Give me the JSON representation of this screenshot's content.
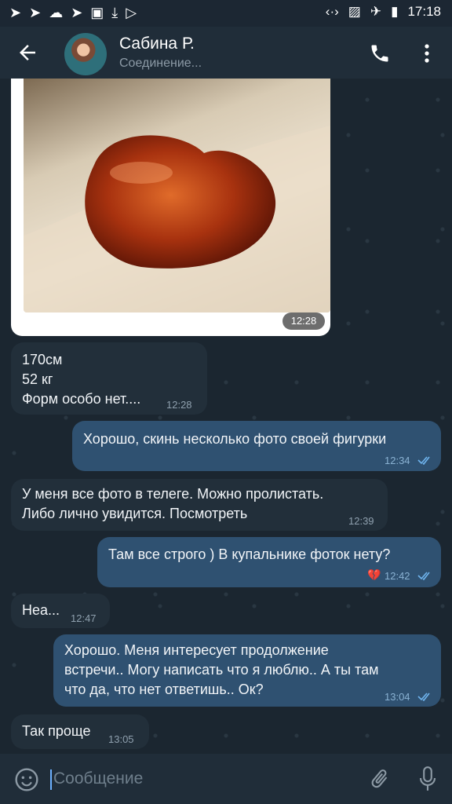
{
  "status_bar": {
    "time": "17:18"
  },
  "header": {
    "name": "Сабина Р.",
    "status": "Соединение..."
  },
  "photo_message": {
    "time": "12:28"
  },
  "messages": [
    {
      "dir": "in",
      "text": "170см\n52 кг\nФорм особо нет....",
      "time": "12:28"
    },
    {
      "dir": "out",
      "text": "Хорошо, скинь несколько фото своей фигурки",
      "time": "12:34"
    },
    {
      "dir": "in",
      "text": "У меня все фото в телеге. Можно пролистать.\nЛибо лично увидится. Посмотреть",
      "time": "12:39"
    },
    {
      "dir": "out",
      "text": "Там все строго ) В купальнике фоток нету?",
      "time": "12:42",
      "reaction": "💔"
    },
    {
      "dir": "in",
      "text": "Неа...",
      "time": "12:47"
    },
    {
      "dir": "out",
      "text": "Хорошо. Меня интересует продолжение\nвстречи.. Могу написать что я люблю.. А ты там\nчто да, что нет ответишь.. Ок?",
      "time": "13:04"
    },
    {
      "dir": "in",
      "text": "Так проще",
      "time": "13:05"
    }
  ],
  "input": {
    "placeholder": "Сообщение"
  },
  "colors": {
    "incoming": "#222f3a",
    "outgoing": "#2f5171",
    "accent": "#6cb0ff"
  },
  "icons": [
    "telegram-icon",
    "cloud-icon",
    "image-icon",
    "download-icon",
    "play-store-icon",
    "back-arrow-icon",
    "phone-icon",
    "more-vert-icon",
    "emoji-icon",
    "attach-icon",
    "mic-icon",
    "double-check-icon",
    "broken-heart-icon"
  ]
}
